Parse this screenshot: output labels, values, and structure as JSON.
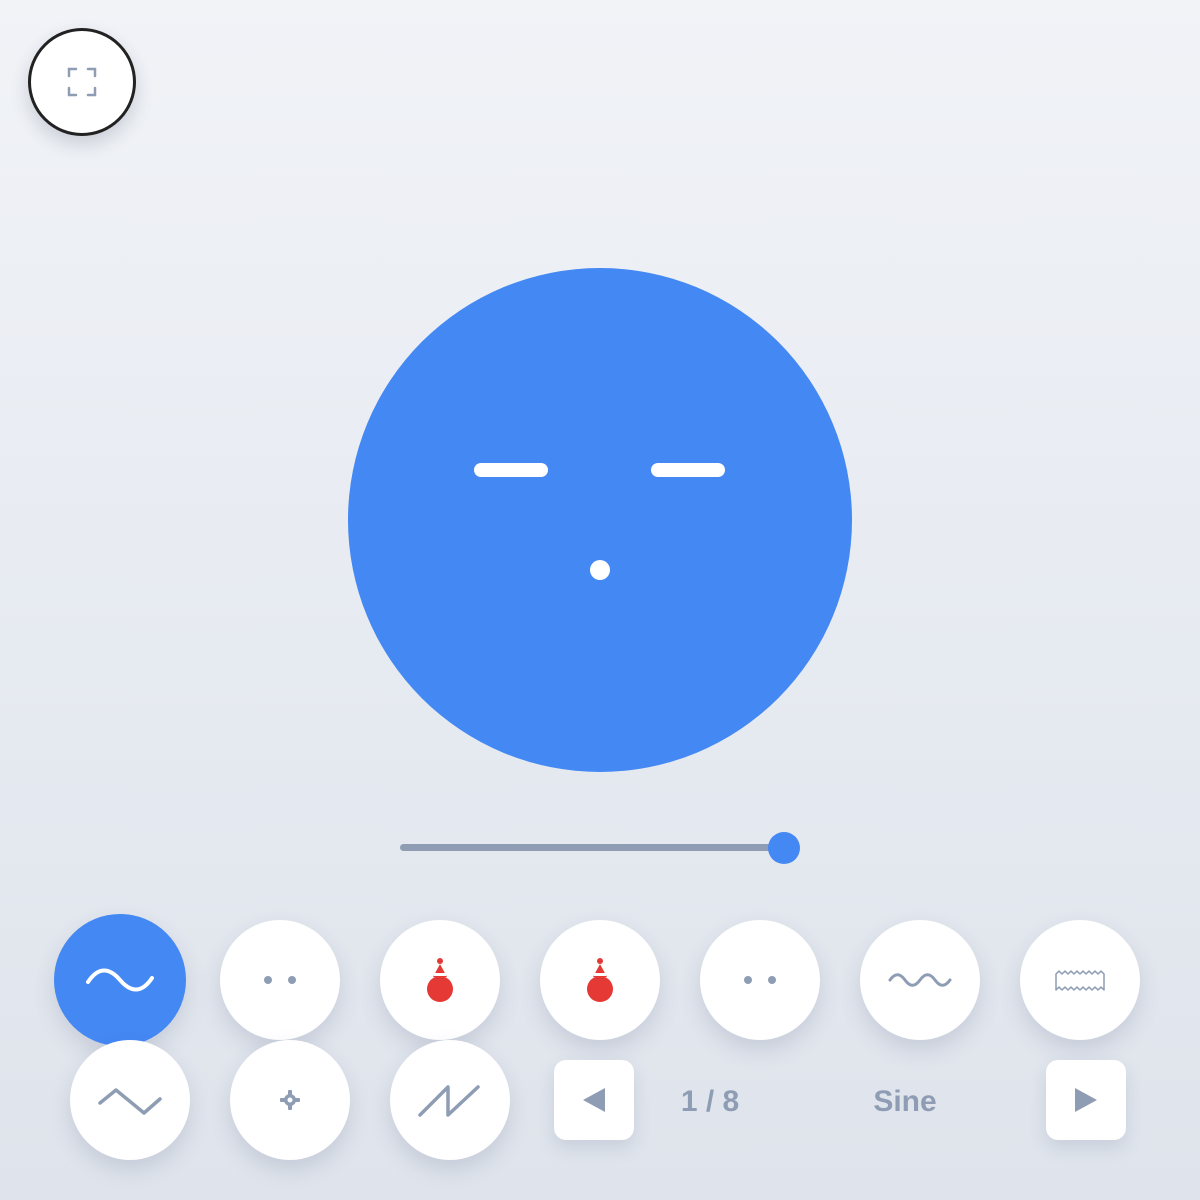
{
  "fullscreen": {
    "icon": "fullscreen-icon"
  },
  "face": {
    "color": "#4488f4",
    "expression": "calm"
  },
  "slider": {
    "value_fraction": 0.96,
    "color": "#4488f4"
  },
  "waveforms": [
    {
      "icon": "sine-wave-icon",
      "active": true
    },
    {
      "icon": "two-dots-icon",
      "active": false
    },
    {
      "icon": "red-bell-icon",
      "active": false
    },
    {
      "icon": "red-bell-icon",
      "active": false
    },
    {
      "icon": "two-dots-icon",
      "active": false
    },
    {
      "icon": "squiggle-wave-icon",
      "active": false
    },
    {
      "icon": "ruler-wave-icon",
      "active": false
    },
    {
      "icon": "triangle-wave-icon",
      "active": false
    },
    {
      "icon": "small-gear-icon",
      "active": false
    },
    {
      "icon": "sawtooth-wave-icon",
      "active": false
    }
  ],
  "pager": {
    "counter": "1 / 8",
    "wave_name": "Sine",
    "prev_icon": "triangle-left-icon",
    "next_icon": "triangle-right-icon"
  },
  "colors": {
    "accent": "#4488f4",
    "muted": "#8e9db4",
    "bell": "#e53935"
  }
}
